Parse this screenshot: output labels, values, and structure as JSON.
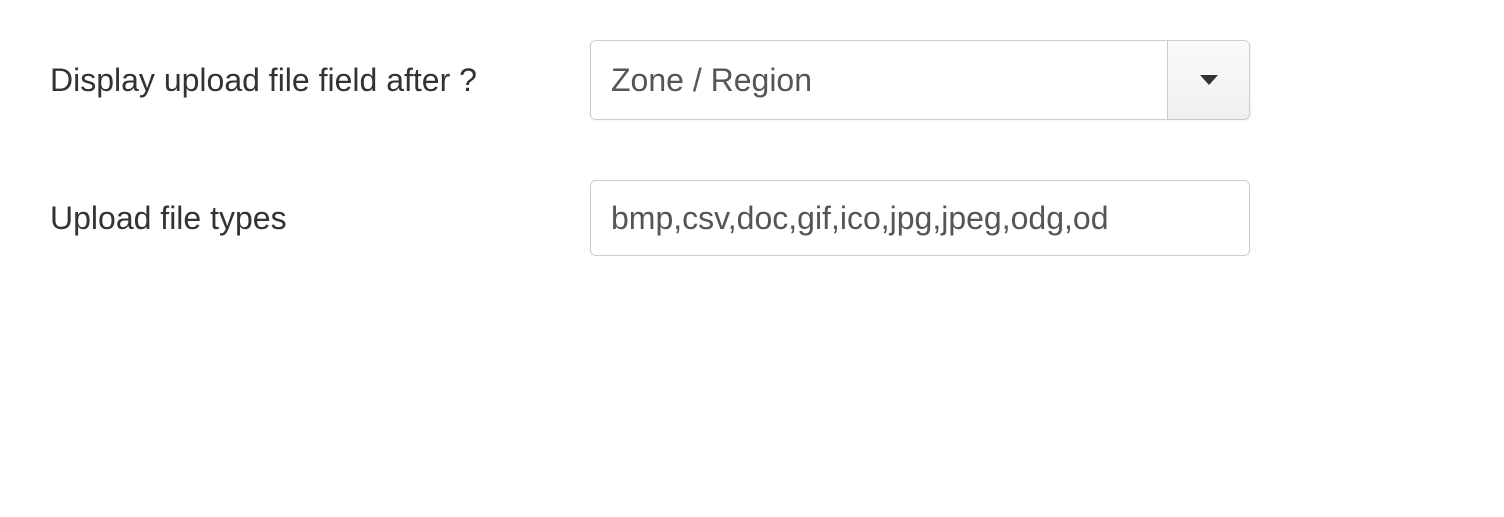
{
  "fields": {
    "display_after": {
      "label": "Display upload file field after ?",
      "selected": "Zone / Region"
    },
    "file_types": {
      "label": "Upload file types",
      "value": "bmp,csv,doc,gif,ico,jpg,jpeg,odg,od"
    }
  }
}
